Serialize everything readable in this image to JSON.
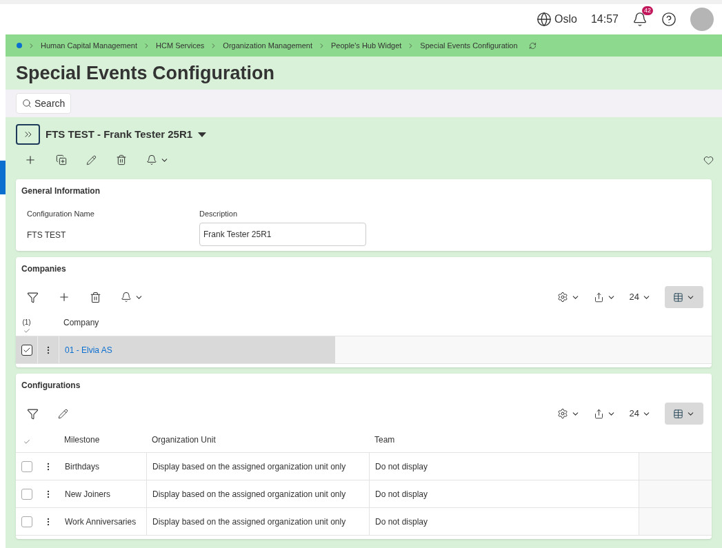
{
  "topbar": {
    "location": "Oslo",
    "time": "14:57",
    "notification_count": "42"
  },
  "breadcrumb": {
    "items": [
      "Human Capital Management",
      "HCM Services",
      "Organization Management",
      "People's Hub Widget",
      "Special Events Configuration"
    ]
  },
  "title": "Special Events Configuration",
  "search_button": "Search",
  "record": {
    "title": "FTS TEST - Frank Tester 25R1"
  },
  "general_information": {
    "title": "General Information",
    "fields": [
      {
        "label": "Configuration Name",
        "value": "FTS TEST",
        "kind": "text"
      },
      {
        "label": "Description",
        "value": "Frank Tester 25R1",
        "kind": "input"
      }
    ]
  },
  "companies": {
    "title": "Companies",
    "selected_count": "(1)",
    "page_size": "24",
    "columns": [
      "Company"
    ],
    "rows": [
      {
        "cells": [
          "01 - Elvia AS"
        ],
        "selected": true
      }
    ]
  },
  "configurations": {
    "title": "Configurations",
    "page_size": "24",
    "columns": [
      "Milestone",
      "Organization Unit",
      "Team"
    ],
    "rows": [
      {
        "cells": [
          "Birthdays",
          "Display based on the assigned organization unit only",
          "Do not display"
        ],
        "selected": false
      },
      {
        "cells": [
          "New Joiners",
          "Display based on the assigned organization unit only",
          "Do not display"
        ],
        "selected": false
      },
      {
        "cells": [
          "Work Anniversaries",
          "Display based on the assigned organization unit only",
          "Do not display"
        ],
        "selected": false
      }
    ]
  }
}
